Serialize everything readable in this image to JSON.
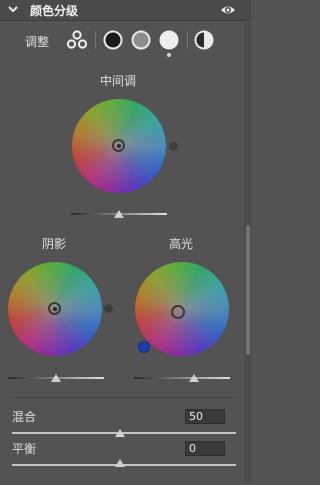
{
  "header": {
    "title": "颜色分级",
    "collapse_icon": "chevron-down-icon",
    "visibility_icon": "eye-icon"
  },
  "adjust": {
    "label": "调整",
    "modes": [
      "three-way",
      "shadows",
      "midtones",
      "highlights",
      "global"
    ],
    "selected_mode": "highlights"
  },
  "wheels": {
    "midtones": {
      "title": "中间调",
      "luminance": 0.5
    },
    "shadows": {
      "title": "阴影",
      "luminance": 0.5
    },
    "highlights": {
      "title": "高光",
      "luminance": 0.6
    }
  },
  "blending": {
    "label": "混合",
    "value": "50",
    "fraction": 0.5
  },
  "balance": {
    "label": "平衡",
    "value": "0",
    "fraction": 0.5
  },
  "colors": {
    "panel_bg": "#535353",
    "highlight_tint_dot": "#1f3cb0"
  }
}
